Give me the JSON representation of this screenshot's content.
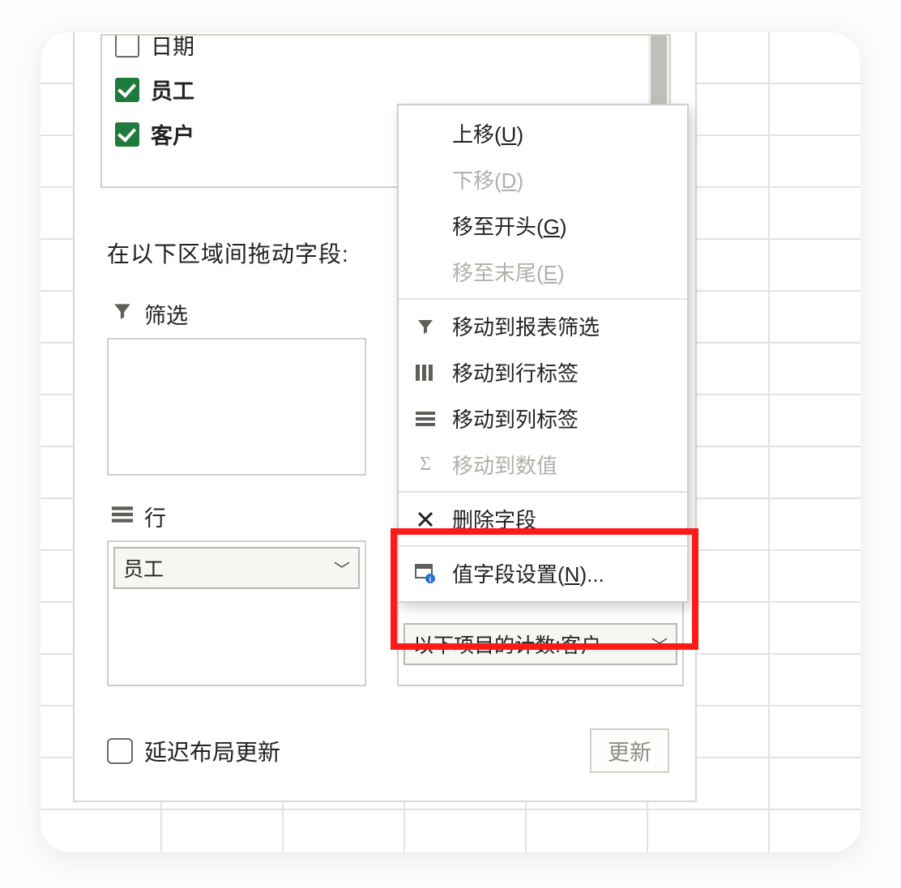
{
  "fields": {
    "date": "日期",
    "employee": "员工",
    "customer": "客户"
  },
  "drag_label": "在以下区域间拖动字段:",
  "area_labels": {
    "filter": "筛选",
    "rows": "行"
  },
  "rows_item": "员工",
  "values_item": "以下项目的计数:客户",
  "footer": {
    "defer": "延迟布局更新",
    "update": "更新"
  },
  "ctx": {
    "move_up": "上移(",
    "move_up_k": "U",
    "move_down": "下移(",
    "move_down_k": "D",
    "move_begin": "移至开头(",
    "move_begin_k": "G",
    "move_end": "移至末尾(",
    "move_end_k": "E",
    "to_filter": "移动到报表筛选",
    "to_rows": "移动到行标签",
    "to_cols": "移动到列标签",
    "to_values": "移动到数值",
    "remove": "删除字段",
    "settings": "值字段设置(",
    "settings_k": "N",
    "settings_suffix": ")...",
    "close_paren": ")"
  }
}
